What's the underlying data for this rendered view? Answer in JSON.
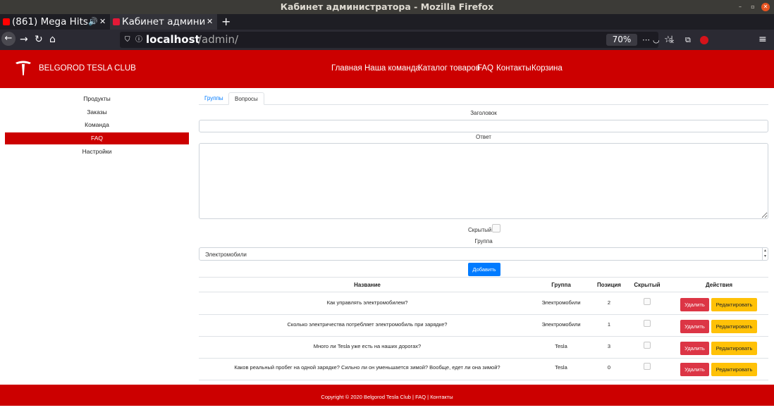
{
  "window": {
    "title": "Кабинет администратора - Mozilla Firefox"
  },
  "browser": {
    "tabs": [
      {
        "label": "(861) Mega Hits",
        "icon": "youtube-icon"
      },
      {
        "label": "Кабинет админис",
        "icon": "tesla-favicon-icon"
      }
    ],
    "new_tab_label": "+",
    "url_host": "localhost",
    "url_path": "/admin/",
    "zoom": "70%"
  },
  "site": {
    "brand": "BELGOROD TESLA CLUB",
    "nav": [
      "Главная",
      "Наша команда",
      "Каталог товаров",
      "FAQ",
      "Контакты",
      "Корзина"
    ]
  },
  "sidebar": {
    "items": [
      {
        "label": "Продукты",
        "active": false
      },
      {
        "label": "Заказы",
        "active": false
      },
      {
        "label": "Команда",
        "active": false
      },
      {
        "label": "FAQ",
        "active": true
      },
      {
        "label": "Настройки",
        "active": false
      }
    ]
  },
  "content": {
    "tabs": [
      {
        "label": "Группы",
        "active": false
      },
      {
        "label": "Вопросы",
        "active": true
      }
    ],
    "form": {
      "title_label": "Заголовок",
      "title_value": "",
      "answer_label": "Ответ",
      "answer_value": "",
      "hidden_label": "Скрытый",
      "hidden_checked": false,
      "group_label": "Группа",
      "group_selected": "Электромобили",
      "submit_label": "Добавить"
    },
    "table": {
      "headers": {
        "name": "Название",
        "group": "Группа",
        "position": "Позиция",
        "hidden": "Скрытый",
        "actions": "Действия"
      },
      "delete_label": "Удалить",
      "edit_label": "Редактировать",
      "rows": [
        {
          "name": "Как управлять электромобилем?",
          "group": "Электромобили",
          "position": "2",
          "hidden": false
        },
        {
          "name": "Сколько электричества потребляет электромобиль при зарядке?",
          "group": "Электромобили",
          "position": "1",
          "hidden": false
        },
        {
          "name": "Много ли Tesla уже есть на наших дорогах?",
          "group": "Tesla",
          "position": "3",
          "hidden": false
        },
        {
          "name": "Каков реальный пробег на одной зарядке? Сильно ли он уменьшается зимой? Вообще, едет ли она зимой?",
          "group": "Tesla",
          "position": "0",
          "hidden": false
        }
      ]
    }
  },
  "footer": {
    "text": "Copyright © 2020 Belgorod Tesla Club | FAQ | Контакты"
  },
  "colors": {
    "brand_red": "#cc0000",
    "primary": "#007bff",
    "danger": "#dc3545",
    "warning": "#ffc107"
  }
}
